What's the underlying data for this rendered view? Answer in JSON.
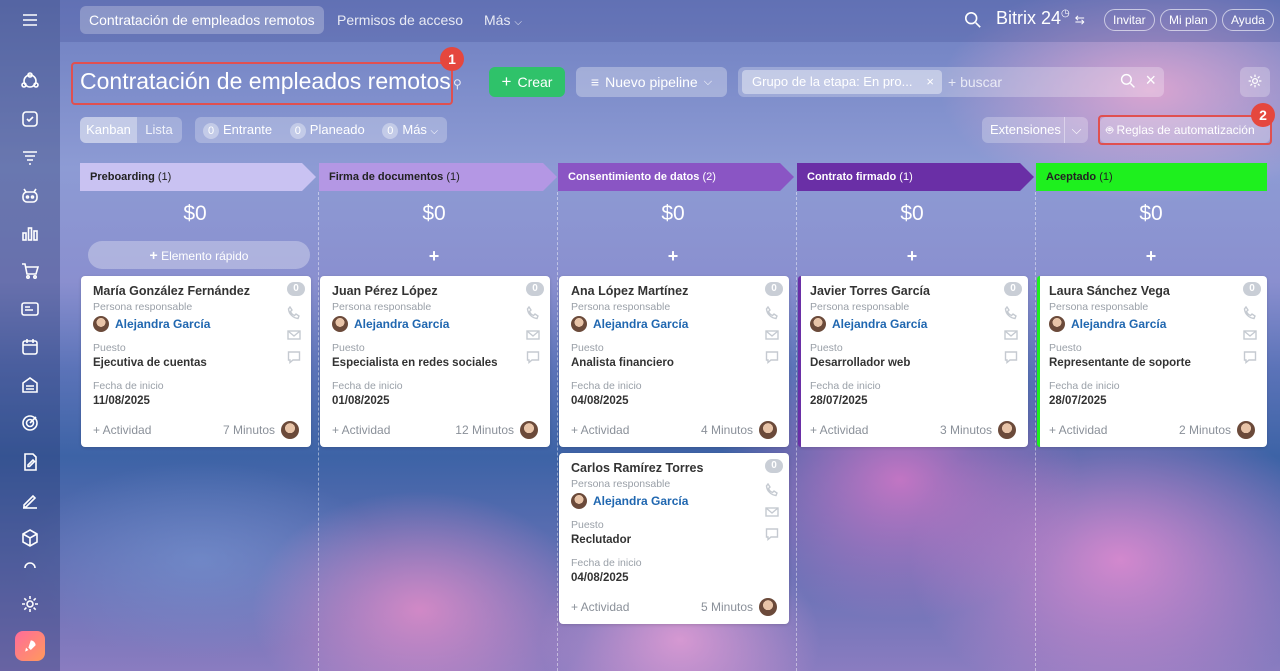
{
  "sidebar": {
    "icons": [
      "menu-icon",
      "crm-icon",
      "tasks-icon",
      "filter-icon",
      "robot-icon",
      "analytics-icon",
      "shop-icon",
      "contact-card-icon",
      "calendar-icon",
      "building-icon",
      "target-icon",
      "document-edit-icon",
      "signature-icon",
      "box-icon",
      "more-icon",
      "settings-icon",
      "rocket-icon"
    ]
  },
  "topbar": {
    "tabs": [
      "Contratación de empleados remotos",
      "Permisos de acceso",
      "Más"
    ],
    "brand": "Bitrix",
    "brand_num": "24",
    "invite": "Invitar",
    "plan": "Mi plan",
    "help": "Ayuda"
  },
  "header": {
    "title": "Contratación de empleados remotos",
    "create_label": "Crear",
    "pipeline_label": "Nuevo pipeline",
    "filter_chip": "Grupo de la etapa: En pro...",
    "search_placeholder": "+ buscar",
    "badge1": "1",
    "badge2": "2"
  },
  "toolbar": {
    "kanban": "Kanban",
    "lista": "Lista",
    "entrante_count": "0",
    "entrante": "Entrante",
    "planeado_count": "0",
    "planeado": "Planeado",
    "mas_count": "0",
    "mas": "Más",
    "extensiones": "Extensiones",
    "reglas": "Reglas de automatización"
  },
  "columns": [
    {
      "name": "Preboarding",
      "count": "(1)",
      "sum": "$0",
      "color": "#c9c2f2"
    },
    {
      "name": "Firma de documentos",
      "count": "(1)",
      "sum": "$0",
      "color": "#b497e4"
    },
    {
      "name": "Consentimiento de datos",
      "count": "(2)",
      "sum": "$0",
      "color": "#8a55c4"
    },
    {
      "name": "Contrato firmado",
      "count": "(1)",
      "sum": "$0",
      "color": "#6a2fa6"
    },
    {
      "name": "Aceptado",
      "count": "(1)",
      "sum": "$0",
      "color": "#1ef01e"
    }
  ],
  "quick_add": "Elemento rápido",
  "plus": "+",
  "labels": {
    "responsible": "Persona responsable",
    "position": "Puesto",
    "start": "Fecha de inicio",
    "activity": "+ Actividad",
    "zero": "0"
  },
  "cards": [
    {
      "name": "María González Fernández",
      "owner": "Alejandra García",
      "position": "Ejecutiva de cuentas",
      "date": "11/08/2025",
      "time": "7 Minutos"
    },
    {
      "name": "Juan Pérez López",
      "owner": "Alejandra García",
      "position": "Especialista en redes sociales",
      "date": "01/08/2025",
      "time": "12 Minutos"
    },
    {
      "name": "Ana López Martínez",
      "owner": "Alejandra García",
      "position": "Analista financiero",
      "date": "04/08/2025",
      "time": "4 Minutos"
    },
    {
      "name": "Carlos Ramírez Torres",
      "owner": "Alejandra García",
      "position": "Reclutador",
      "date": "04/08/2025",
      "time": "5 Minutos"
    },
    {
      "name": "Javier Torres García",
      "owner": "Alejandra García",
      "position": "Desarrollador web",
      "date": "28/07/2025",
      "time": "3 Minutos"
    },
    {
      "name": "Laura Sánchez Vega",
      "owner": "Alejandra García",
      "position": "Representante de soporte",
      "date": "28/07/2025",
      "time": "2 Minutos"
    }
  ]
}
